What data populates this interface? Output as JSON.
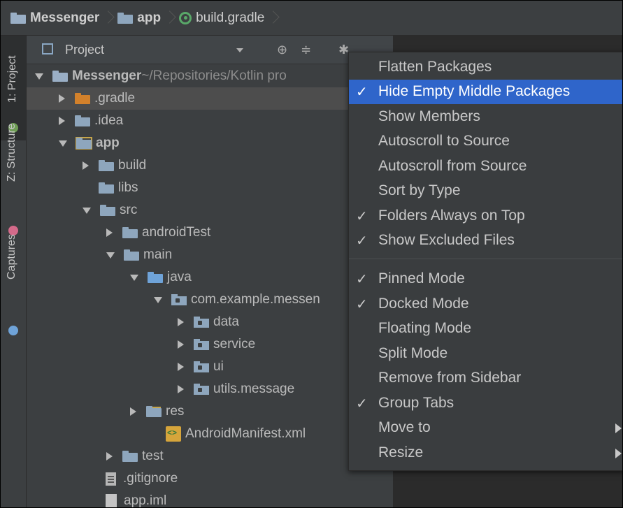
{
  "breadcrumb": {
    "project": "Messenger",
    "module": "app",
    "file": "build.gradle"
  },
  "tool_strip": {
    "tabs": [
      "1: Project",
      "Z: Structure",
      "Captures"
    ]
  },
  "panel": {
    "title": "Project"
  },
  "tree": [
    {
      "label": "Messenger",
      "path": " ~/Repositories/Kotlin pro"
    },
    {
      "label": ".gradle"
    },
    {
      "label": ".idea"
    },
    {
      "label": "app"
    },
    {
      "label": "build"
    },
    {
      "label": "libs"
    },
    {
      "label": "src"
    },
    {
      "label": "androidTest"
    },
    {
      "label": "main"
    },
    {
      "label": "java"
    },
    {
      "label": "com.example.messen"
    },
    {
      "label": "data"
    },
    {
      "label": "service"
    },
    {
      "label": "ui"
    },
    {
      "label": "utils.message"
    },
    {
      "label": "res"
    },
    {
      "label": "AndroidManifest.xml"
    },
    {
      "label": "test"
    },
    {
      "label": ".gitignore"
    },
    {
      "label": "app.iml"
    }
  ],
  "menu": {
    "items": [
      {
        "label": "Flatten Packages",
        "checked": false
      },
      {
        "label": "Hide Empty Middle Packages",
        "checked": true
      },
      {
        "label": "Show Members",
        "checked": false
      },
      {
        "label": "Autoscroll to Source",
        "checked": false
      },
      {
        "label": "Autoscroll from Source",
        "checked": false
      },
      {
        "label": "Sort by Type",
        "checked": false
      },
      {
        "label": "Folders Always on Top",
        "checked": true
      },
      {
        "label": "Show Excluded Files",
        "checked": true
      },
      {
        "label": "Pinned Mode",
        "checked": true
      },
      {
        "label": "Docked Mode",
        "checked": true
      },
      {
        "label": "Floating Mode",
        "checked": false
      },
      {
        "label": "Split Mode",
        "checked": false
      },
      {
        "label": "Remove from Sidebar",
        "checked": false
      },
      {
        "label": "Group Tabs",
        "checked": true
      },
      {
        "label": "Move to",
        "checked": false
      },
      {
        "label": "Resize",
        "checked": false
      }
    ],
    "check_glyph": "✓"
  },
  "colors": {
    "menu_highlight": "#2f65ca",
    "panel_bg": "#3c3f41",
    "editor_bg": "#2b2b2b"
  }
}
